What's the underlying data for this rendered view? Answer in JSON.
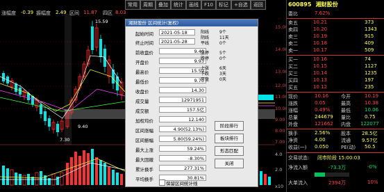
{
  "top_info": {
    "pct_label": "涨幅度",
    "pct_value": "-0.39",
    "amp_label": "振幅度",
    "amp_value": "2.49",
    "mid_label1": "区间",
    "mid_value1": "11.87",
    "mid_label2": "四区",
    "mid_value2": "8.03"
  },
  "toolbar": [
    "常用",
    "周期",
    "叠加",
    "统计",
    "画线",
    "F10",
    "标记",
    "+自选",
    "返回"
  ],
  "price_axis": [
    "15.00",
    "14.00",
    "13.00",
    "12.00",
    "11.00",
    "10.00",
    "9.00",
    "8.00",
    "7.00"
  ],
  "chart_annotations": {
    "high": "15.59",
    "low1": "9.40",
    "low2": "7.30"
  },
  "volume_axis": [
    "4.0",
    "2.0",
    "x10"
  ],
  "quote": {
    "code": "600895",
    "name": "湘财股份",
    "header": [
      {
        "label": "委比",
        "value": "7.62%",
        "label2": "委差",
        "value2": "",
        "color": "#ff4444"
      }
    ],
    "asks": [
      {
        "label": "卖五",
        "price": "10.21",
        "vol": "373"
      },
      {
        "label": "卖四",
        "price": "10.20",
        "vol": "1343"
      },
      {
        "label": "卖三",
        "price": "10.19",
        "vol": "915"
      },
      {
        "label": "卖二",
        "price": "10.18",
        "vol": "409"
      },
      {
        "label": "卖一",
        "price": "10.17",
        "vol": "509"
      }
    ],
    "bids": [
      {
        "label": "买一",
        "price": "10.16",
        "vol": "74"
      },
      {
        "label": "买二",
        "price": "10.15",
        "vol": "1127"
      },
      {
        "label": "买三",
        "price": "10.14",
        "vol": "1235"
      },
      {
        "label": "买四",
        "price": "10.13",
        "vol": "197"
      },
      {
        "label": "买五",
        "price": "10.12",
        "vol": "235"
      }
    ],
    "stats": [
      {
        "l1": "现价",
        "v1": "10.16",
        "l2": "今开",
        "v2": "10.19"
      },
      {
        "l1": "涨跌",
        "v1": "0.05",
        "l2": "最高",
        "v2": "10.38"
      },
      {
        "l1": "涨幅",
        "v1": "0.49%",
        "l2": "最低",
        "v2": "10.06"
      },
      {
        "l1": "总量",
        "v1": "244679",
        "l2": "量比",
        "v2": "0.75"
      },
      {
        "l1": "外盘",
        "v1": "121662",
        "l2": "内盘",
        "v2": "122077"
      },
      {
        "l1": "换手",
        "v1": "2.56%",
        "l2": "股本",
        "v2": "28.5亿"
      },
      {
        "l1": "净资",
        "v1": "4.00",
        "l2": "流通",
        "v2": "9.57亿"
      },
      {
        "l1": "收益(一)",
        "v1": "0.050",
        "l2": "PE(动)",
        "v2": "50.5"
      }
    ],
    "status": {
      "label": "交易状态:",
      "value": "闭市阶段 15:00:03"
    },
    "flows": [
      {
        "label": "净流入额",
        "v1": "-73.3万",
        "v2": "-0%"
      },
      {
        "label": "大单流入",
        "v1": "2394万",
        "v2": "10%"
      }
    ]
  },
  "dialog": {
    "title": "湘财股份 区间统计(复权)",
    "start_label": "起始时间",
    "start_value": "2021-05-18",
    "end_label": "终止时间",
    "end_value": "2021-05-28",
    "fields": [
      {
        "label": "前收盘价",
        "value": "9.40"
      },
      {
        "label": "开盘价",
        "value": "9.93"
      },
      {
        "label": "最高价",
        "value": "15.59"
      },
      {
        "label": "最低价",
        "value": "9.70"
      },
      {
        "label": "收盘价",
        "value": "14.30"
      },
      {
        "label": "成交量",
        "value": "12971951"
      },
      {
        "label": "成交额",
        "value": "157.5亿"
      },
      {
        "label": "加权均价",
        "value": "12.140"
      },
      {
        "label": "区间涨幅",
        "value": "4.90(52.13%)"
      },
      {
        "label": "区间振幅",
        "value": "5.80(59.24%)"
      },
      {
        "label": "最大上涨",
        "value": "59.24%"
      },
      {
        "label": "最大回撤",
        "value": "-8.30%"
      },
      {
        "label": "累计换手",
        "value": "277.31%"
      },
      {
        "label": "平均换手",
        "value": "30.81%"
      }
    ],
    "stats": [
      {
        "label": "阳线",
        "value": "9个"
      },
      {
        "label": "阴线",
        "value": "11天"
      },
      {
        "label": "平线",
        "value": "0个"
      },
      {
        "label": "涨停",
        "value": "5个"
      },
      {
        "label": "跌停",
        "value": "0个"
      },
      {
        "label": "上涨",
        "value": "6天"
      },
      {
        "label": "下跌",
        "value": "3天"
      },
      {
        "label": "平盘",
        "value": "0天"
      }
    ],
    "buttons": [
      "阶段排行",
      "板块排行",
      "形态匹配",
      "关闭"
    ],
    "checkbox_label": "保留区间统计线"
  }
}
